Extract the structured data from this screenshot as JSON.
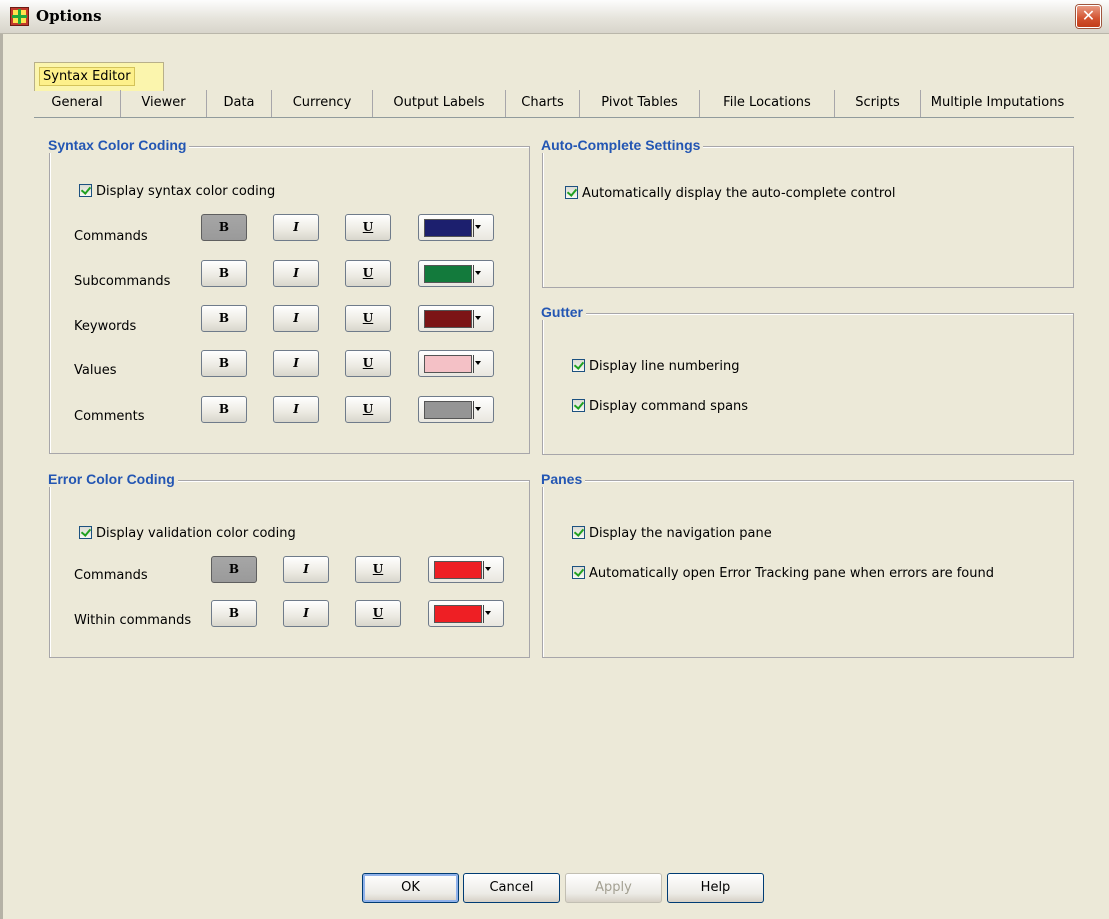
{
  "window": {
    "title": "Options",
    "close_glyph": "✕"
  },
  "tabs": {
    "selected": "Syntax Editor",
    "row": [
      "General",
      "Viewer",
      "Data",
      "Currency",
      "Output Labels",
      "Charts",
      "Pivot Tables",
      "File Locations",
      "Scripts",
      "Multiple Imputations"
    ]
  },
  "syntax_color_coding": {
    "title": "Syntax Color Coding",
    "display_checkbox": {
      "label": "Display syntax color coding",
      "checked": true
    },
    "rows": [
      {
        "label": "Commands",
        "bold": true,
        "italic": false,
        "underline": false,
        "color": "#1c1f6e"
      },
      {
        "label": "Subcommands",
        "bold": false,
        "italic": false,
        "underline": false,
        "color": "#137a3c"
      },
      {
        "label": "Keywords",
        "bold": false,
        "italic": false,
        "underline": false,
        "color": "#7c1416"
      },
      {
        "label": "Values",
        "bold": false,
        "italic": false,
        "underline": false,
        "color": "#f4c1c6"
      },
      {
        "label": "Comments",
        "bold": false,
        "italic": false,
        "underline": false,
        "color": "#959595"
      }
    ]
  },
  "error_color_coding": {
    "title": "Error Color Coding",
    "display_checkbox": {
      "label": "Display validation color coding",
      "checked": true
    },
    "rows": [
      {
        "label": "Commands",
        "bold": true,
        "italic": false,
        "underline": false,
        "color": "#ee1f24"
      },
      {
        "label": "Within commands",
        "bold": false,
        "italic": false,
        "underline": false,
        "color": "#ee1f24"
      }
    ]
  },
  "format_labels": {
    "bold": "B",
    "italic": "I",
    "underline": "U"
  },
  "auto_complete": {
    "title": "Auto-Complete Settings",
    "checkbox": {
      "label": "Automatically display the auto-complete control",
      "checked": true
    }
  },
  "gutter": {
    "title": "Gutter",
    "checkboxes": [
      {
        "label": "Display line numbering",
        "checked": true
      },
      {
        "label": "Display command spans",
        "checked": true
      }
    ]
  },
  "panes": {
    "title": "Panes",
    "checkboxes": [
      {
        "label": "Display the navigation pane",
        "checked": true
      },
      {
        "label": "Automatically open Error Tracking pane when errors are found",
        "checked": true
      }
    ]
  },
  "buttons": {
    "ok": "OK",
    "cancel": "Cancel",
    "apply": "Apply",
    "help": "Help"
  },
  "icons": {
    "app": "spss-options-icon",
    "close": "close-icon",
    "dropdown": "dropdown-arrow-icon"
  }
}
